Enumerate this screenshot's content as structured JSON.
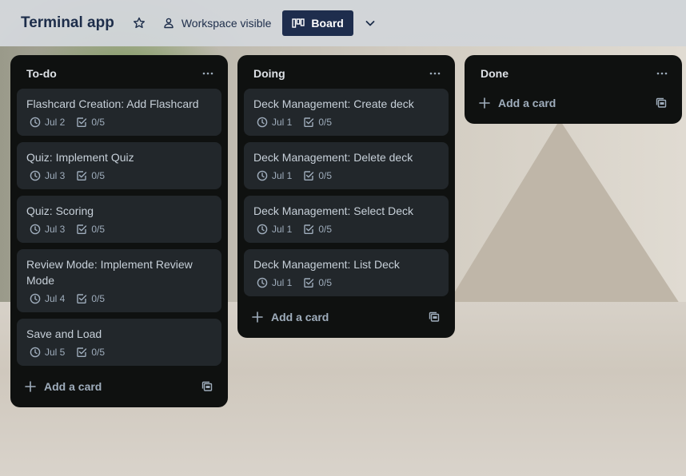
{
  "board": {
    "title": "Terminal app",
    "visibility_label": "Workspace visible",
    "view_label": "Board"
  },
  "add_card_label": "Add a card",
  "lists": [
    {
      "title": "To-do",
      "cards": [
        {
          "title": "Flashcard Creation: Add Flashcard",
          "date": "Jul 2",
          "checklist": "0/5"
        },
        {
          "title": "Quiz: Implement Quiz",
          "date": "Jul 3",
          "checklist": "0/5"
        },
        {
          "title": "Quiz: Scoring",
          "date": "Jul 3",
          "checklist": "0/5"
        },
        {
          "title": "Review Mode: Implement Review Mode",
          "date": "Jul 4",
          "checklist": "0/5"
        },
        {
          "title": "Save and Load",
          "date": "Jul 5",
          "checklist": "0/5"
        }
      ]
    },
    {
      "title": "Doing",
      "cards": [
        {
          "title": "Deck Management: Create deck",
          "date": "Jul 1",
          "checklist": "0/5"
        },
        {
          "title": "Deck Management: Delete deck",
          "date": "Jul 1",
          "checklist": "0/5"
        },
        {
          "title": "Deck Management: Select Deck",
          "date": "Jul 1",
          "checklist": "0/5"
        },
        {
          "title": "Deck Management: List Deck",
          "date": "Jul 1",
          "checklist": "0/5"
        }
      ]
    },
    {
      "title": "Done",
      "cards": []
    }
  ],
  "colors": {
    "list_bg": "#0f1110",
    "card_bg": "#22272b",
    "card_text": "#c7d0d9",
    "badge_text": "#9fadbc",
    "header_text": "#1d2d4a",
    "board_button_bg": "#1e2d4d"
  },
  "icons": {
    "star": "star-icon",
    "visibility": "people-icon",
    "board_view": "board-icon",
    "chevron": "chevron-down-icon",
    "list_menu": "more-icon",
    "due_date": "clock-icon",
    "checklist": "checkbox-icon",
    "add": "plus-icon",
    "template": "template-icon"
  }
}
